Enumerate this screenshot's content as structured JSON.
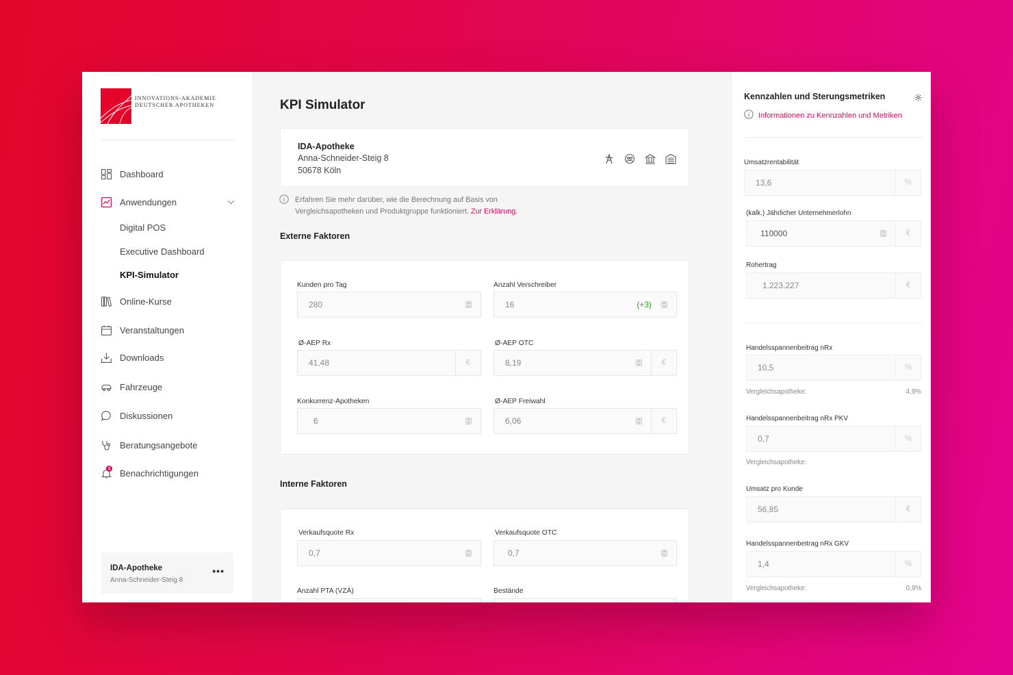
{
  "brand": {
    "line1": "INNOVATIONS-AKADEMIE",
    "line2": "DEUTSCHER APOTHEKEN",
    "accent_color": "#e3062a"
  },
  "sidebar": {
    "items": [
      {
        "label": "Dashboard",
        "icon": "dashboard-icon"
      },
      {
        "label": "Anwendungen",
        "icon": "chart-icon"
      },
      {
        "label": "Online-Kurse",
        "icon": "books-icon"
      },
      {
        "label": "Veranstaltungen",
        "icon": "calendar-icon"
      },
      {
        "label": "Downloads",
        "icon": "download-icon"
      },
      {
        "label": "Fahrzeuge",
        "icon": "car-icon"
      },
      {
        "label": "Diskussionen",
        "icon": "chat-icon"
      },
      {
        "label": "Beratungsangebote",
        "icon": "stethoscope-icon"
      },
      {
        "label": "Benachrichtigungen",
        "icon": "bell-icon",
        "badge": "2"
      }
    ],
    "subitems": [
      "Digital POS",
      "Executive Dashboard",
      "KPI-Simulator"
    ],
    "active_subitem": "KPI-Simulator",
    "profile": {
      "name": "IDA-Apotheke",
      "address": "Anna-Schneider-Steig 8",
      "menu": "•••"
    }
  },
  "main": {
    "title": "KPI Simulator",
    "pharmacy": {
      "name": "IDA-Apotheke",
      "street": "Anna-Schneider-Steig 8",
      "city": "50678 Köln"
    },
    "info": {
      "line1": "Erfahren Sie mehr darüber, wie die Berechnung auf Basis von",
      "line2": "Vergleichsapotheken und Produktgruppe funktioniert.",
      "link": "Zur Erklärung."
    },
    "external": {
      "title": "Externe Faktoren",
      "fields": {
        "kunden": {
          "label": "Kunden pro Tag",
          "value": "280"
        },
        "verschreiber": {
          "label": "Anzahl Verschreiber",
          "value": "16",
          "delta": "(+3)"
        },
        "aep_rx": {
          "label": "Ø-AEP Rx",
          "value": "41,48",
          "unit": "€"
        },
        "aep_otc": {
          "label": "Ø-AEP OTC",
          "value": "8,19",
          "unit": "€"
        },
        "konkurrenz": {
          "label": "Konkurrenz-Apotheken",
          "value": "6"
        },
        "aep_frei": {
          "label": "Ø-AEP Freiwahl",
          "value": "6,06",
          "unit": "€"
        }
      }
    },
    "internal": {
      "title": "Interne Faktoren",
      "fields": {
        "vq_rx": {
          "label": "Verkaufsquote Rx",
          "value": "0,7"
        },
        "vq_otc": {
          "label": "Verkaufsquote OTC",
          "value": "0,7"
        },
        "pta": {
          "label": "Anzahl PTA (VZÄ)"
        },
        "bestaende": {
          "label": "Bestände"
        }
      }
    }
  },
  "right_panel": {
    "title": "Kennzahlen und Sterungsmetriken",
    "info_link": "Informationen zu Kennzahlen und Metriken",
    "metrics": {
      "umsatzrentabilitaet": {
        "label": "Umsatzrentabilität",
        "value": "13,6",
        "unit": "%"
      },
      "lohn": {
        "label": "(kalk.) Jährlicher Unternehmerlohn",
        "value": "110000",
        "unit": "€"
      },
      "rohertrag": {
        "label": "Rohertrag",
        "value": "1.223.227",
        "unit": "€"
      },
      "nrx": {
        "label": "Handelsspannenbeitrag nRx",
        "value": "10,5",
        "unit": "%",
        "compare_label": "Vergleichsapotheke:",
        "compare_value": "4,9%"
      },
      "nrx_pkv": {
        "label": "Handelsspannenbeitrag nRx PKV",
        "value": "0,7",
        "unit": "%",
        "compare_label": "Vergleichsapotheke:"
      },
      "umsatz_kunde": {
        "label": "Umsatz pro Kunde",
        "value": "56,85",
        "unit": "€"
      },
      "nrx_gkv": {
        "label": "Handelsspannenbeitrag nRx GKV",
        "value": "1,4",
        "unit": "%",
        "compare_label": "Vergleichsapotheke:",
        "compare_value": "0,9%"
      }
    }
  }
}
